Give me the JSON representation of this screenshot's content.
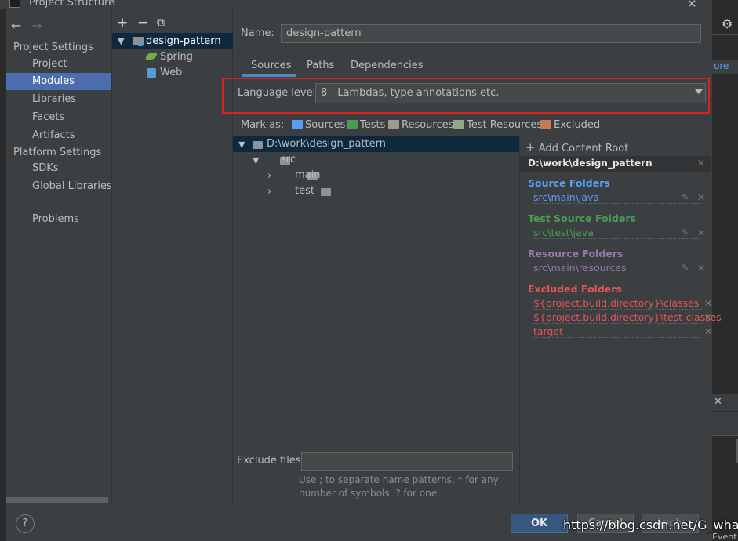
{
  "window": {
    "title": "Project Structure",
    "close_glyph": "✕"
  },
  "colors": {
    "selection": "#4b6eaf",
    "tree_selection": "#0d293e",
    "source": "#589df6",
    "test": "#499c54",
    "resource": "#9876aa",
    "excluded": "#e05555",
    "highlight_box": "#e02020",
    "ok_button": "#365880"
  },
  "nav": {
    "back_glyph": "←",
    "forward_glyph": "→",
    "project_settings_header": "Project Settings",
    "project_settings": [
      "Project",
      "Modules",
      "Libraries",
      "Facets",
      "Artifacts"
    ],
    "platform_settings_header": "Platform Settings",
    "platform_settings": [
      "SDKs",
      "Global Libraries"
    ],
    "problems": "Problems",
    "selected": "Modules"
  },
  "module_tree": {
    "toolbar": {
      "add": "+",
      "remove": "−",
      "copy": "⧉"
    },
    "root": "design-pattern",
    "children": [
      "Spring",
      "Web"
    ]
  },
  "module": {
    "name_label": "Name:",
    "name_value": "design-pattern",
    "tabs": [
      "Sources",
      "Paths",
      "Dependencies"
    ],
    "active_tab": "Sources",
    "language_level_label": "Language level:",
    "language_level_value": "8 - Lambdas, type annotations etc.",
    "mark_as_label": "Mark as:",
    "mark_as": [
      "Sources",
      "Tests",
      "Resources",
      "Test Resources",
      "Excluded"
    ]
  },
  "content_tree": {
    "root": "D:\\work\\design_pattern",
    "src": "src",
    "main": "main",
    "test": "test"
  },
  "content_root": {
    "add_label": "Add Content Root",
    "root_path": "D:\\work\\design_pattern",
    "source_folders_header": "Source Folders",
    "source_folders": [
      "src\\main\\java"
    ],
    "test_source_folders_header": "Test Source Folders",
    "test_source_folders": [
      "src\\test\\java"
    ],
    "resource_folders_header": "Resource Folders",
    "resource_folders": [
      "src\\main\\resources"
    ],
    "excluded_folders_header": "Excluded Folders",
    "excluded_folders": [
      "${project.build.directory}\\classes",
      "${project.build.directory}\\test-classes",
      "target"
    ]
  },
  "exclude": {
    "label": "Exclude files:",
    "value": "",
    "hint_line1": "Use ; to separate name patterns, * for any",
    "hint_line2": "number of symbols, ? for one."
  },
  "buttons": {
    "help": "?",
    "ok": "OK",
    "cancel": "Cancel",
    "apply": "Apply"
  },
  "background_ide": {
    "more_label": "ore",
    "event_log": "Event Log"
  },
  "watermark": "https://blog.csdn.net/G_whang"
}
